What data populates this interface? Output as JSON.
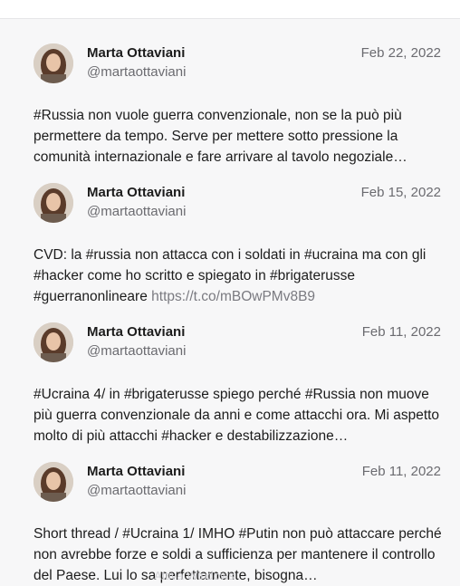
{
  "posts": [
    {
      "author": "Marta Ottaviani",
      "handle": "@martaottaviani",
      "date": "Feb 22, 2022",
      "text": "#Russia non vuole guerra convenzionale, non se la può più permettere da tempo. Serve per mettere sotto pressione la comunità internazionale e fare arrivare al tavolo negoziale…",
      "link": ""
    },
    {
      "author": "Marta Ottaviani",
      "handle": "@martaottaviani",
      "date": "Feb 15, 2022",
      "text": "CVD: la #russia non attacca con i soldati in #ucraina ma con gli #hacker come ho scritto e spiegato in #brigaterusse #guerranonlineare",
      "link": "https://t.co/mBOwPMv8B9"
    },
    {
      "author": "Marta Ottaviani",
      "handle": "@martaottaviani",
      "date": "Feb 11, 2022",
      "text": "#Ucraina 4/ in #brigaterusse spiego perché #Russia non muove più guerra convenzionale da anni e come attacchi ora. Mi aspetto molto di più attacchi #hacker e destabilizzazione…",
      "link": ""
    },
    {
      "author": "Marta Ottaviani",
      "handle": "@martaottaviani",
      "date": "Feb 11, 2022",
      "text": "Short thread / #Ucraina 1/ IMHO #Putin non può attaccare perché non avrebbe forze e soldi a sufficienza per mantenere il controllo del Paese. Lui lo sa perfettamente, bisogna…",
      "link": ""
    }
  ],
  "overlay": {
    "watermark": "Attiva Windows"
  }
}
